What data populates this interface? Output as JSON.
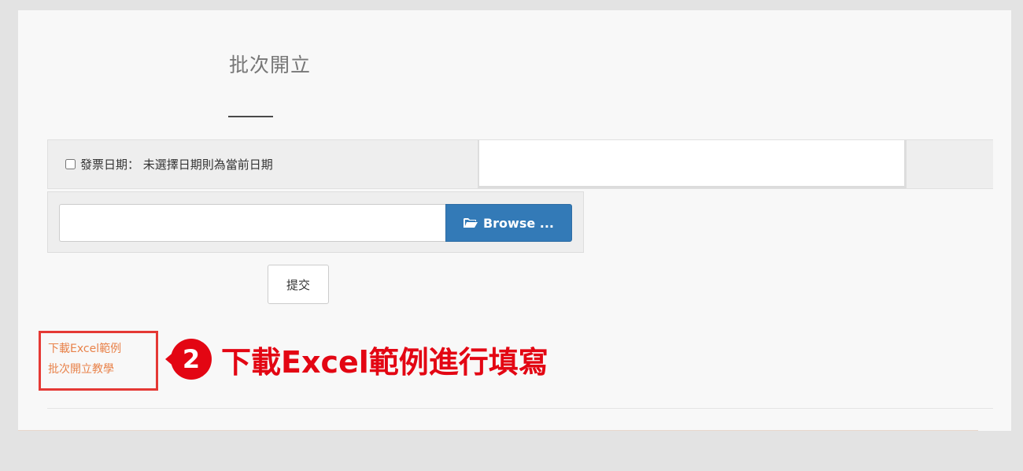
{
  "form": {
    "title": "批次開立",
    "date_label": "發票日期： 未選擇日期則為當前日期",
    "date_value": "",
    "file_value": "",
    "browse_label": "Browse ...",
    "submit_label": "提交"
  },
  "links": {
    "download_example": "下載Excel範例",
    "tutorial": "批次開立教學"
  },
  "callout": {
    "number": "2",
    "text": "下載Excel範例進行填寫",
    "color": "#e30613"
  },
  "colors": {
    "primary_button": "#337ab7",
    "link": "#e8824a",
    "highlight_border": "#e53935"
  }
}
